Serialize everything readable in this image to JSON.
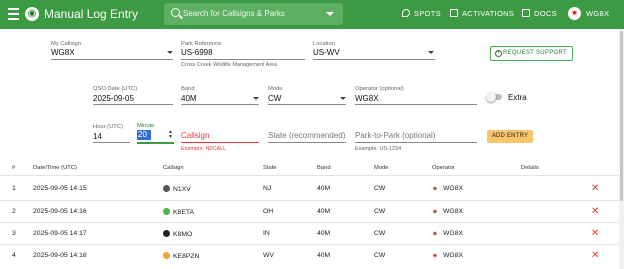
{
  "header": {
    "title": "Manual Log Entry",
    "search_placeholder": "Search for Callsigns & Parks",
    "nav": [
      "SPOTS",
      "ACTIVATIONS",
      "DOCS"
    ],
    "user": "WG8X"
  },
  "form": {
    "my_callsign": {
      "label": "My Callsign",
      "value": "WG8X"
    },
    "park_reference": {
      "label": "Park Reference",
      "value": "US-6998",
      "helper": "Cross Creek Wildlife Management Area"
    },
    "location": {
      "label": "Location",
      "value": "US-WV"
    },
    "request_support": "REQUEST SUPPORT",
    "qso_date": {
      "label": "QSO Date (UTC)",
      "value": "2025-09-05"
    },
    "band": {
      "label": "Band",
      "value": "40M"
    },
    "mode": {
      "label": "Mode",
      "value": "CW"
    },
    "operator": {
      "label": "Operator (optional)",
      "value": "WG8X"
    },
    "extra_label": "Extra",
    "hour": {
      "label": "Hour (UTC)",
      "value": "14"
    },
    "minute": {
      "label": "Minute",
      "value": "20"
    },
    "callsign": {
      "placeholder": "Callsign",
      "helper": "Example: N0CALL"
    },
    "state": {
      "placeholder": "State (recommended)"
    },
    "p2p": {
      "placeholder": "Park-to-Park (optional)",
      "helper": "Example: US-1234"
    },
    "add_entry": "ADD ENTRY"
  },
  "table": {
    "headers": [
      "#",
      "Date/Time (UTC)",
      "Callsign",
      "State",
      "Band",
      "Mode",
      "Operator",
      "Details"
    ],
    "rows": [
      {
        "n": "1",
        "dt": "2025-09-05 14:15",
        "call": "N1XV",
        "state": "NJ",
        "band": "40M",
        "mode": "CW",
        "op": "WG8X"
      },
      {
        "n": "2",
        "dt": "2025-09-05 14:16",
        "call": "K8ETA",
        "state": "OH",
        "band": "40M",
        "mode": "CW",
        "op": "WG8X"
      },
      {
        "n": "3",
        "dt": "2025-09-05 14:17",
        "call": "K8MO",
        "state": "IN",
        "band": "40M",
        "mode": "CW",
        "op": "WG8X"
      },
      {
        "n": "4",
        "dt": "2025-09-05 14:18",
        "call": "KE8PZN",
        "state": "WV",
        "band": "40M",
        "mode": "CW",
        "op": "WG8X"
      }
    ]
  },
  "colors": {
    "accent": "#3c9a42",
    "error": "#e53935",
    "add_button": "#f7c56b"
  },
  "icons": {
    "menu": "menu-icon",
    "search": "search-icon",
    "delete": "close-icon"
  }
}
